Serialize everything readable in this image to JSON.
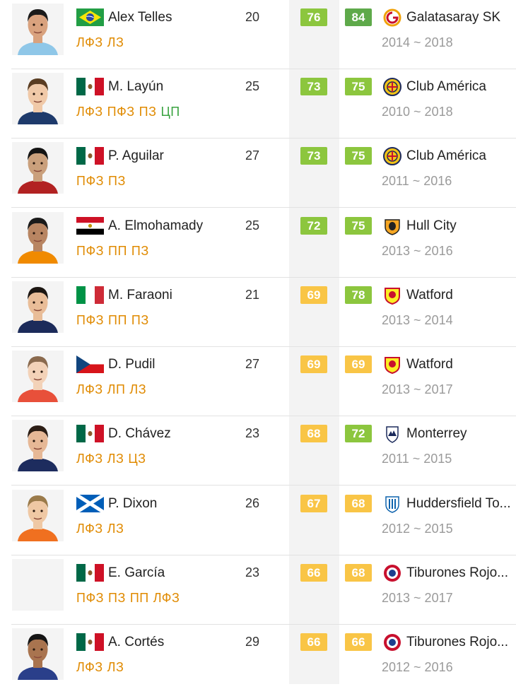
{
  "players": [
    {
      "name": "Alex Telles",
      "country": "brazil",
      "age": "20",
      "overall": "76",
      "overall_color": "#8cc63e",
      "potential": "84",
      "potential_color": "#5ea94a",
      "team": "Galatasaray SK",
      "team_logo": "galatasaray-logo",
      "years": "2014 ~ 2018",
      "positions": [
        {
          "label": "ЛФЗ",
          "type": "def"
        },
        {
          "label": "ЛЗ",
          "type": "def"
        }
      ]
    },
    {
      "name": "M. Layún",
      "country": "mexico",
      "age": "25",
      "overall": "73",
      "overall_color": "#8cc63e",
      "potential": "75",
      "potential_color": "#8cc63e",
      "team": "Club América",
      "team_logo": "club-america-logo",
      "years": "2010 ~ 2018",
      "positions": [
        {
          "label": "ЛФЗ",
          "type": "def"
        },
        {
          "label": "ПФЗ",
          "type": "def"
        },
        {
          "label": "ПЗ",
          "type": "def"
        },
        {
          "label": "ЦП",
          "type": "mid"
        }
      ]
    },
    {
      "name": "P. Aguilar",
      "country": "mexico",
      "age": "27",
      "overall": "73",
      "overall_color": "#8cc63e",
      "potential": "75",
      "potential_color": "#8cc63e",
      "team": "Club América",
      "team_logo": "club-america-logo",
      "years": "2011 ~ 2016",
      "positions": [
        {
          "label": "ПФЗ",
          "type": "def"
        },
        {
          "label": "ПЗ",
          "type": "def"
        }
      ]
    },
    {
      "name": "A. Elmohamady",
      "country": "egypt",
      "age": "25",
      "overall": "72",
      "overall_color": "#8cc63e",
      "potential": "75",
      "potential_color": "#8cc63e",
      "team": "Hull City",
      "team_logo": "hull-city-logo",
      "years": "2013 ~ 2016",
      "positions": [
        {
          "label": "ПФЗ",
          "type": "def"
        },
        {
          "label": "ПП",
          "type": "def"
        },
        {
          "label": "ПЗ",
          "type": "def"
        }
      ]
    },
    {
      "name": "M. Faraoni",
      "country": "italy",
      "age": "21",
      "overall": "69",
      "overall_color": "#f9c546",
      "potential": "78",
      "potential_color": "#8cc63e",
      "team": "Watford",
      "team_logo": "watford-logo",
      "years": "2013 ~ 2014",
      "positions": [
        {
          "label": "ПФЗ",
          "type": "def"
        },
        {
          "label": "ПП",
          "type": "def"
        },
        {
          "label": "ПЗ",
          "type": "def"
        }
      ]
    },
    {
      "name": "D. Pudil",
      "country": "czech",
      "age": "27",
      "overall": "69",
      "overall_color": "#f9c546",
      "potential": "69",
      "potential_color": "#f9c546",
      "team": "Watford",
      "team_logo": "watford-logo",
      "years": "2013 ~ 2017",
      "positions": [
        {
          "label": "ЛФЗ",
          "type": "def"
        },
        {
          "label": "ЛП",
          "type": "def"
        },
        {
          "label": "ЛЗ",
          "type": "def"
        }
      ]
    },
    {
      "name": "D. Chávez",
      "country": "mexico",
      "age": "23",
      "overall": "68",
      "overall_color": "#f9c546",
      "potential": "72",
      "potential_color": "#8cc63e",
      "team": "Monterrey",
      "team_logo": "monterrey-logo",
      "years": "2011 ~ 2015",
      "positions": [
        {
          "label": "ЛФЗ",
          "type": "def"
        },
        {
          "label": "ЛЗ",
          "type": "def"
        },
        {
          "label": "ЦЗ",
          "type": "def"
        }
      ]
    },
    {
      "name": "P. Dixon",
      "country": "scotland",
      "age": "26",
      "overall": "67",
      "overall_color": "#f9c546",
      "potential": "68",
      "potential_color": "#f9c546",
      "team": "Huddersfield To...",
      "team_logo": "huddersfield-logo",
      "years": "2012 ~ 2015",
      "positions": [
        {
          "label": "ЛФЗ",
          "type": "def"
        },
        {
          "label": "ЛЗ",
          "type": "def"
        }
      ]
    },
    {
      "name": "E. García",
      "country": "mexico",
      "age": "23",
      "overall": "66",
      "overall_color": "#f9c546",
      "potential": "68",
      "potential_color": "#f9c546",
      "team": "Tiburones Rojo...",
      "team_logo": "tiburones-logo",
      "years": "2013 ~ 2017",
      "positions": [
        {
          "label": "ПФЗ",
          "type": "def"
        },
        {
          "label": "ПЗ",
          "type": "def"
        },
        {
          "label": "ПП",
          "type": "def"
        },
        {
          "label": "ЛФЗ",
          "type": "def"
        }
      ]
    },
    {
      "name": "A. Cortés",
      "country": "mexico",
      "age": "29",
      "overall": "66",
      "overall_color": "#f9c546",
      "potential": "66",
      "potential_color": "#f9c546",
      "team": "Tiburones Rojo...",
      "team_logo": "tiburones-logo",
      "years": "2012 ~ 2016",
      "positions": [
        {
          "label": "ЛФЗ",
          "type": "def"
        },
        {
          "label": "ЛЗ",
          "type": "def"
        }
      ]
    }
  ]
}
